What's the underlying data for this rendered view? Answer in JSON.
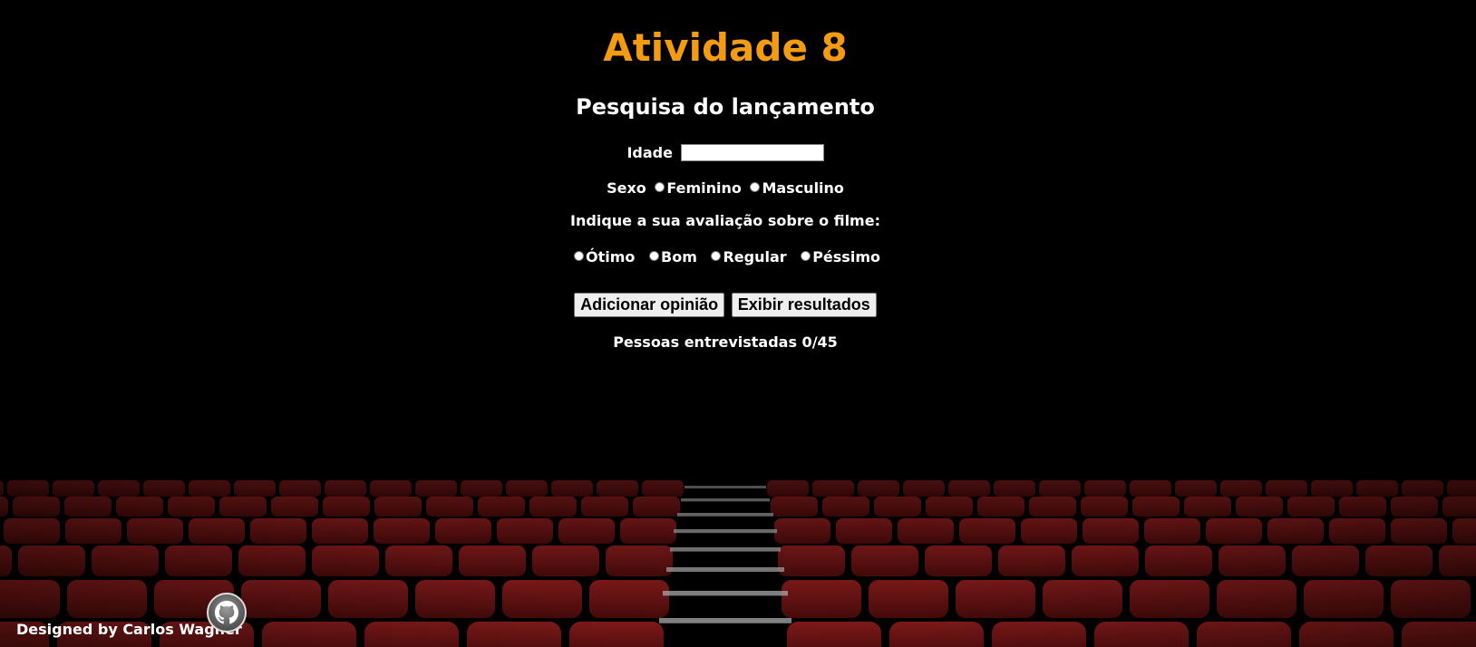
{
  "page": {
    "title": "Atividade 8",
    "subtitle": "Pesquisa do lançamento"
  },
  "form": {
    "idade_label": "Idade",
    "idade_value": "",
    "sexo_label": "Sexo",
    "sexo_options": [
      "Feminino",
      "Masculino"
    ],
    "avaliacao_prompt": "Indique a sua avaliação sobre o filme:",
    "avaliacao_options": [
      "Ótimo",
      "Bom",
      "Regular",
      "Péssimo"
    ],
    "add_button": "Adicionar opinião",
    "show_button": "Exibir resultados",
    "count_text": "Pessoas entrevistadas 0/45"
  },
  "footer": {
    "credit": "Designed by Carlos Wagner",
    "github_icon": "github-icon"
  },
  "colors": {
    "title": "#f39c12",
    "background": "#000000",
    "seats": "#7a1515"
  }
}
